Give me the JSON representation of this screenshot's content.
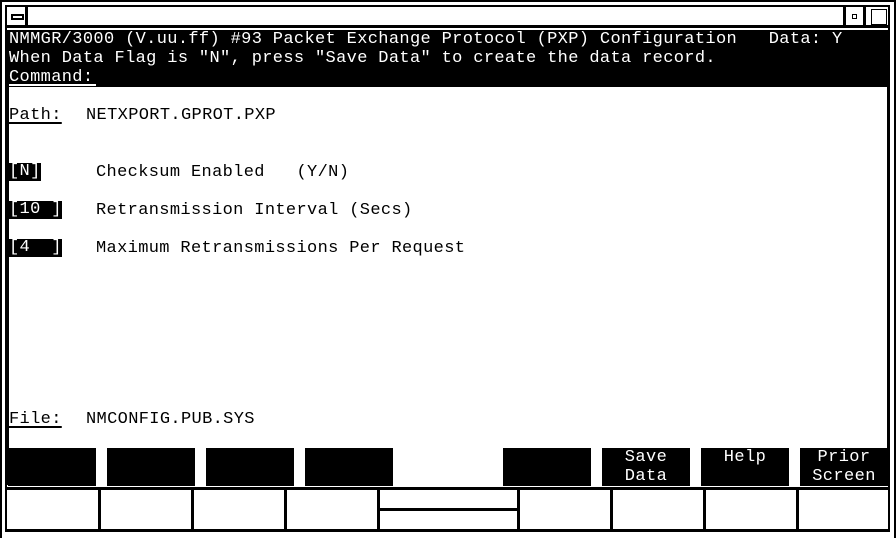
{
  "window": {
    "title": "",
    "system_menu_icon": "system-menu-icon",
    "minimize_icon": "minimize-icon",
    "maximize_icon": "maximize-icon"
  },
  "header": {
    "line1": "NMMGR/3000 (V.uu.ff) #93 Packet Exchange Protocol (PXP) Configuration   Data: Y",
    "line2": "When Data Flag is \"N\", press \"Save Data\" to create the data record.",
    "command_label": "Command:",
    "command_value": ""
  },
  "path": {
    "label": "Path:",
    "value": "NETXPORT.GPROT.PXP"
  },
  "fields": [
    {
      "value": "[N]",
      "label": "Checksum Enabled   (Y/N)"
    },
    {
      "value": "[10 ]",
      "label": "Retransmission Interval (Secs)"
    },
    {
      "value": "[4  ]",
      "label": "Maximum Retransmissions Per Request"
    }
  ],
  "file": {
    "label": "File:",
    "value": "NMCONFIG.PUB.SYS"
  },
  "softkeys": [
    {
      "key": "f1",
      "label_line1": "",
      "label_line2": "",
      "visible": true
    },
    {
      "key": "f2",
      "label_line1": "",
      "label_line2": "",
      "visible": true
    },
    {
      "key": "f3",
      "label_line1": "",
      "label_line2": "",
      "visible": true
    },
    {
      "key": "f4",
      "label_line1": "",
      "label_line2": "",
      "visible": true
    },
    {
      "key": "f5",
      "label_line1": "",
      "label_line2": "",
      "visible": false
    },
    {
      "key": "f6",
      "label_line1": "",
      "label_line2": "",
      "visible": true
    },
    {
      "key": "f7",
      "label_line1": "Save",
      "label_line2": "Data",
      "visible": true
    },
    {
      "key": "f8",
      "label_line1": "Help",
      "label_line2": "",
      "visible": true
    },
    {
      "key": "f9",
      "label_line1": "Prior",
      "label_line2": "Screen",
      "visible": true
    }
  ]
}
